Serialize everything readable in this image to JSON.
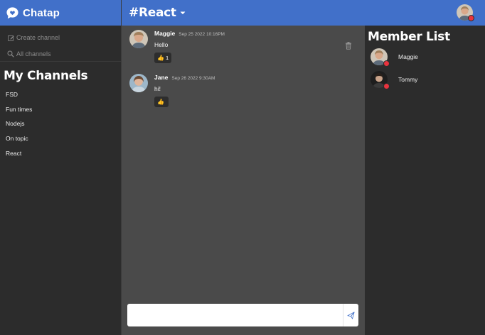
{
  "app": {
    "name": "Chatap"
  },
  "sidebar": {
    "actions": [
      {
        "label": "Create channel",
        "icon": "edit-icon"
      },
      {
        "label": "All channels",
        "icon": "search-icon"
      }
    ],
    "section_title": "My Channels",
    "channels": [
      "FSD",
      "Fun times",
      "Nodejs",
      "On topic",
      "React"
    ]
  },
  "main": {
    "channel_title": "#React",
    "messages": [
      {
        "author": "Maggie",
        "time": "Sep 25 2022 10:16PM",
        "text": "Hello",
        "reaction": {
          "emoji": "👍",
          "count": "1"
        }
      },
      {
        "author": "Jane",
        "time": "Sep 26 2022 9:30AM",
        "text": "hi!",
        "reaction": {
          "emoji": "👍",
          "count": ""
        }
      }
    ],
    "composer": {
      "placeholder": "",
      "value": ""
    }
  },
  "members": {
    "title": "Member List",
    "list": [
      {
        "name": "Maggie",
        "status": "offline"
      },
      {
        "name": "Tommy",
        "status": "offline"
      }
    ]
  },
  "colors": {
    "accent": "#4170c9",
    "status_dot": "#e8333e",
    "sidebar_bg": "#2c2c2c",
    "chat_bg": "#4a4a4a"
  }
}
